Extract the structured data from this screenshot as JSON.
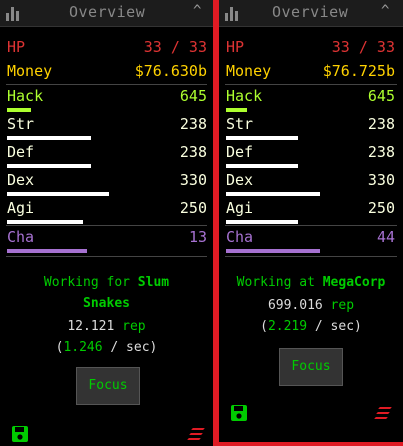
{
  "colors": {
    "hp": "#dd3333",
    "money": "#ffd200",
    "hack": "#adff2f",
    "combat": "#faffdf",
    "cha": "#a671d1",
    "work": "#00cc00",
    "border": "#e01b24"
  },
  "panels": [
    {
      "header": {
        "title": "Overview",
        "icon": "bar-chart-icon",
        "toggle": "^"
      },
      "hp": {
        "label": "HP",
        "value": "33 / 33"
      },
      "money": {
        "label": "Money",
        "value": "$76.630b"
      },
      "stats": [
        {
          "key": "hack",
          "label": "Hack",
          "value": "645",
          "progress": 0.12
        },
        {
          "key": "str",
          "label": "Str",
          "value": "238",
          "progress": 0.42
        },
        {
          "key": "def",
          "label": "Def",
          "value": "238",
          "progress": 0.42
        },
        {
          "key": "dex",
          "label": "Dex",
          "value": "330",
          "progress": 0.51
        },
        {
          "key": "agi",
          "label": "Agi",
          "value": "250",
          "progress": 0.38
        },
        {
          "key": "cha",
          "label": "Cha",
          "value": "13",
          "progress": 0.4
        }
      ],
      "work": {
        "prefix": "Working for ",
        "company": "Slum Snakes",
        "company_line1": "Slum",
        "company_line2": "Snakes",
        "rep": "12.121",
        "rep_label": " rep",
        "rate": "1.246",
        "rate_suffix": " / sec)",
        "rate_prefix": "("
      },
      "focus_label": "Focus"
    },
    {
      "header": {
        "title": "Overview",
        "icon": "bar-chart-icon",
        "toggle": "^"
      },
      "hp": {
        "label": "HP",
        "value": "33 / 33"
      },
      "money": {
        "label": "Money",
        "value": "$76.725b"
      },
      "stats": [
        {
          "key": "hack",
          "label": "Hack",
          "value": "645",
          "progress": 0.12
        },
        {
          "key": "str",
          "label": "Str",
          "value": "238",
          "progress": 0.42
        },
        {
          "key": "def",
          "label": "Def",
          "value": "238",
          "progress": 0.42
        },
        {
          "key": "dex",
          "label": "Dex",
          "value": "330",
          "progress": 0.55
        },
        {
          "key": "agi",
          "label": "Agi",
          "value": "250",
          "progress": 0.42
        },
        {
          "key": "cha",
          "label": "Cha",
          "value": "44",
          "progress": 0.55
        }
      ],
      "work": {
        "prefix": "Working at ",
        "company": "MegaCorp",
        "rep": "699.016",
        "rep_label": " rep",
        "rate": "2.219",
        "rate_suffix": " / sec)",
        "rate_prefix": "("
      },
      "focus_label": "Focus"
    }
  ]
}
